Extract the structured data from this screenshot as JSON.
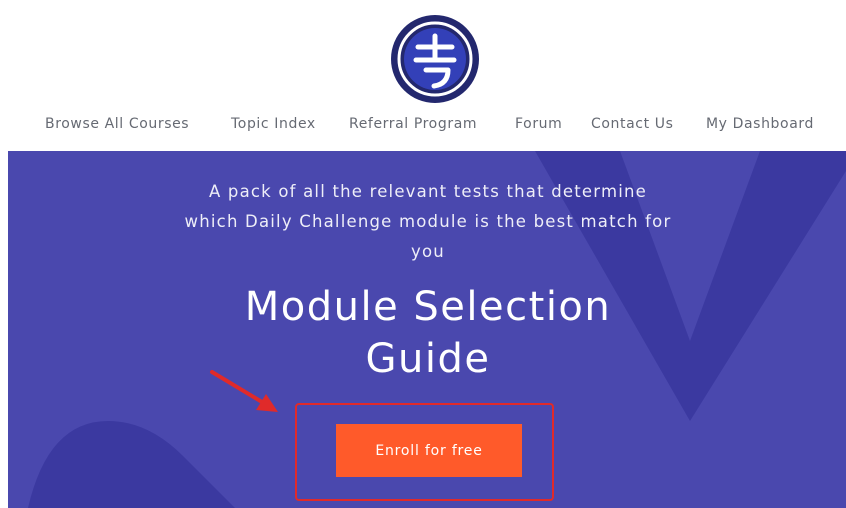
{
  "logo": {
    "icon": "brand-logo-icon"
  },
  "nav": {
    "items": [
      {
        "label": "Browse All Courses"
      },
      {
        "label": "Topic Index"
      },
      {
        "label": "Referral Program"
      },
      {
        "label": "Forum"
      },
      {
        "label": "Contact Us"
      },
      {
        "label": "My Dashboard"
      }
    ]
  },
  "hero": {
    "tagline_lines": [
      "A pack of all the relevant tests that determine",
      "which Daily Challenge module is the best match for",
      "you"
    ],
    "title_lines": [
      "Module Selection",
      "Guide"
    ],
    "cta_label": "Enroll for free"
  },
  "colors": {
    "hero_bg": "#4a48ae",
    "hero_shape": "#3b39a0",
    "cta": "#ff5a2a",
    "nav_text": "#666a73",
    "annotation": "#e02a2a"
  }
}
